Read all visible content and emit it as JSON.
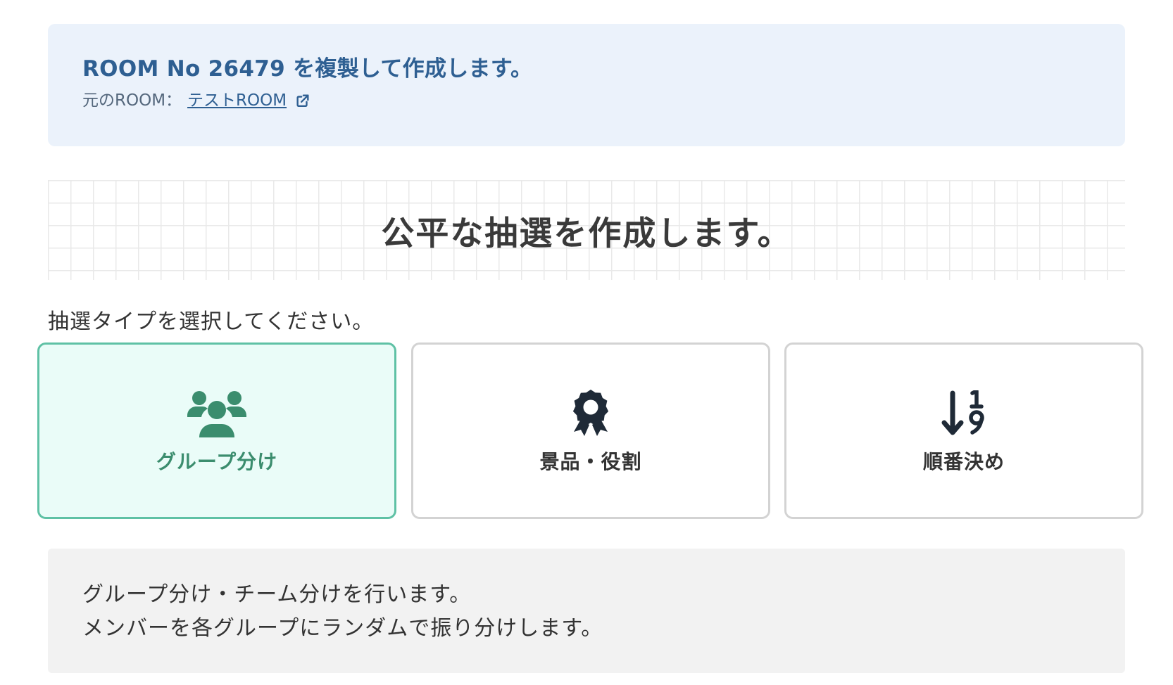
{
  "banner": {
    "title": "ROOM No 26479 を複製して作成します。",
    "source_label": "元のROOM：",
    "source_link": "テストROOM",
    "link_icon": "external-link-icon"
  },
  "hero": {
    "title": "公平な抽選を作成します。"
  },
  "prompt": "抽選タイプを選択してください。",
  "lottery_types": [
    {
      "label": "グループ分け",
      "icon": "users-group-icon",
      "selected": true
    },
    {
      "label": "景品・役割",
      "icon": "award-ribbon-icon",
      "selected": false
    },
    {
      "label": "順番決め",
      "icon": "sort-numeric-down-icon",
      "selected": false
    }
  ],
  "description": {
    "line1": "グループ分け・チーム分けを行います。",
    "line2": "メンバーを各グループにランダムで振り分けします。"
  },
  "colors": {
    "banner_bg": "#ebf2fb",
    "banner_text": "#2e5f92",
    "selected_border": "#5fc1a5",
    "selected_bg": "#eafcf8",
    "selected_text": "#3b8d6e",
    "description_bg": "#f2f2f2"
  }
}
